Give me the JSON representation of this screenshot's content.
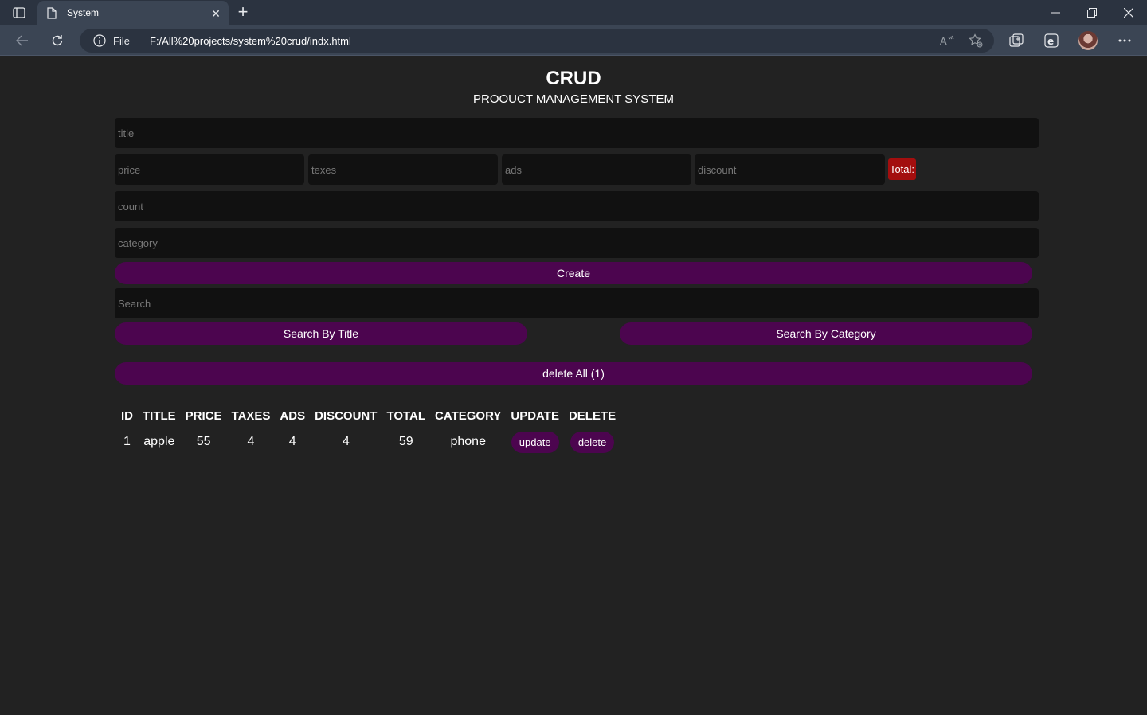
{
  "browser": {
    "tab_title": "System",
    "address_prefix": "File",
    "url": "F:/All%20projects/system%20crud/indx.html",
    "icons": [
      "tab-actions-icon",
      "page-icon",
      "close-icon",
      "plus-icon",
      "minimize-icon",
      "restore-icon",
      "close-window-icon",
      "back-icon",
      "reload-icon",
      "info-icon",
      "read-aloud-icon",
      "favorites-icon",
      "collections-icon",
      "browser-essentials-icon",
      "profile-avatar",
      "more-icon"
    ]
  },
  "header": {
    "title": "CRUD",
    "subtitle": "PROOUCT MANAGEMENT SYSTEM"
  },
  "form": {
    "title_placeholder": "title",
    "price_placeholder": "price",
    "taxes_placeholder": "texes",
    "ads_placeholder": "ads",
    "discount_placeholder": "discount",
    "total_label": "Total:",
    "count_placeholder": "count",
    "category_placeholder": "category",
    "create_label": "Create",
    "search_placeholder": "Search",
    "search_title_label": "Search By Title",
    "search_category_label": "Search By Category",
    "delete_all_label": "delete All (1)"
  },
  "colors": {
    "page_bg": "#222222",
    "input_bg": "#111111",
    "button_purple": "#4c054f",
    "total_red": "#a30e0e"
  },
  "table": {
    "headers": [
      "ID",
      "TITLE",
      "PRICE",
      "TAXES",
      "ADS",
      "DISCOUNT",
      "TOTAL",
      "CATEGORY",
      "UPDATE",
      "DELETE"
    ],
    "rows": [
      {
        "id": "1",
        "title": "apple",
        "price": "55",
        "taxes": "4",
        "ads": "4",
        "discount": "4",
        "total": "59",
        "category": "phone",
        "update_label": "update",
        "delete_label": "delete"
      }
    ]
  }
}
